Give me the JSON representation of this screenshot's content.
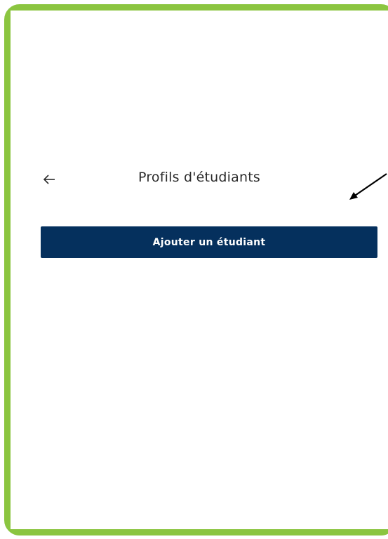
{
  "header": {
    "back_icon": "arrow-left-icon",
    "title": "Profils d'étudiants"
  },
  "actions": {
    "add_student_label": "Ajouter un étudiant"
  },
  "colors": {
    "frame_border": "#8bc540",
    "primary_button": "#05305d",
    "title_text": "#2b2b2b",
    "background": "#ffffff"
  }
}
